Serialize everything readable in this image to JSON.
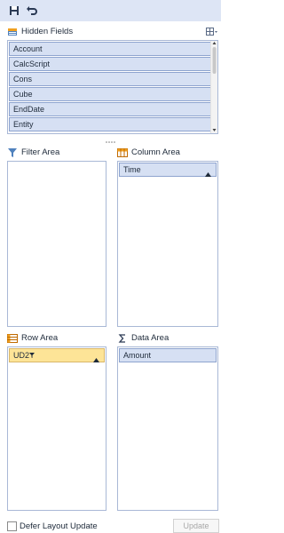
{
  "toolbar": {
    "save_icon": "save-icon",
    "undo_icon": "undo-icon"
  },
  "hidden_fields": {
    "title": "Hidden Fields",
    "items": [
      "Account",
      "CalcScript",
      "Cons",
      "Cube",
      "EndDate",
      "Entity"
    ]
  },
  "areas": {
    "filter": {
      "title": "Filter Area",
      "items": []
    },
    "column": {
      "title": "Column Area",
      "items": [
        "Time"
      ]
    },
    "row": {
      "title": "Row Area",
      "items": [
        "UD2"
      ]
    },
    "data": {
      "title": "Data Area",
      "items": [
        "Amount"
      ]
    }
  },
  "footer": {
    "defer_label": "Defer Layout Update",
    "update_label": "Update"
  },
  "colors": {
    "toolbar_bg": "#dde5f5",
    "item_bg": "#d6e0f3",
    "item_border": "#8ea4cf",
    "highlight_bg": "#fde497"
  }
}
